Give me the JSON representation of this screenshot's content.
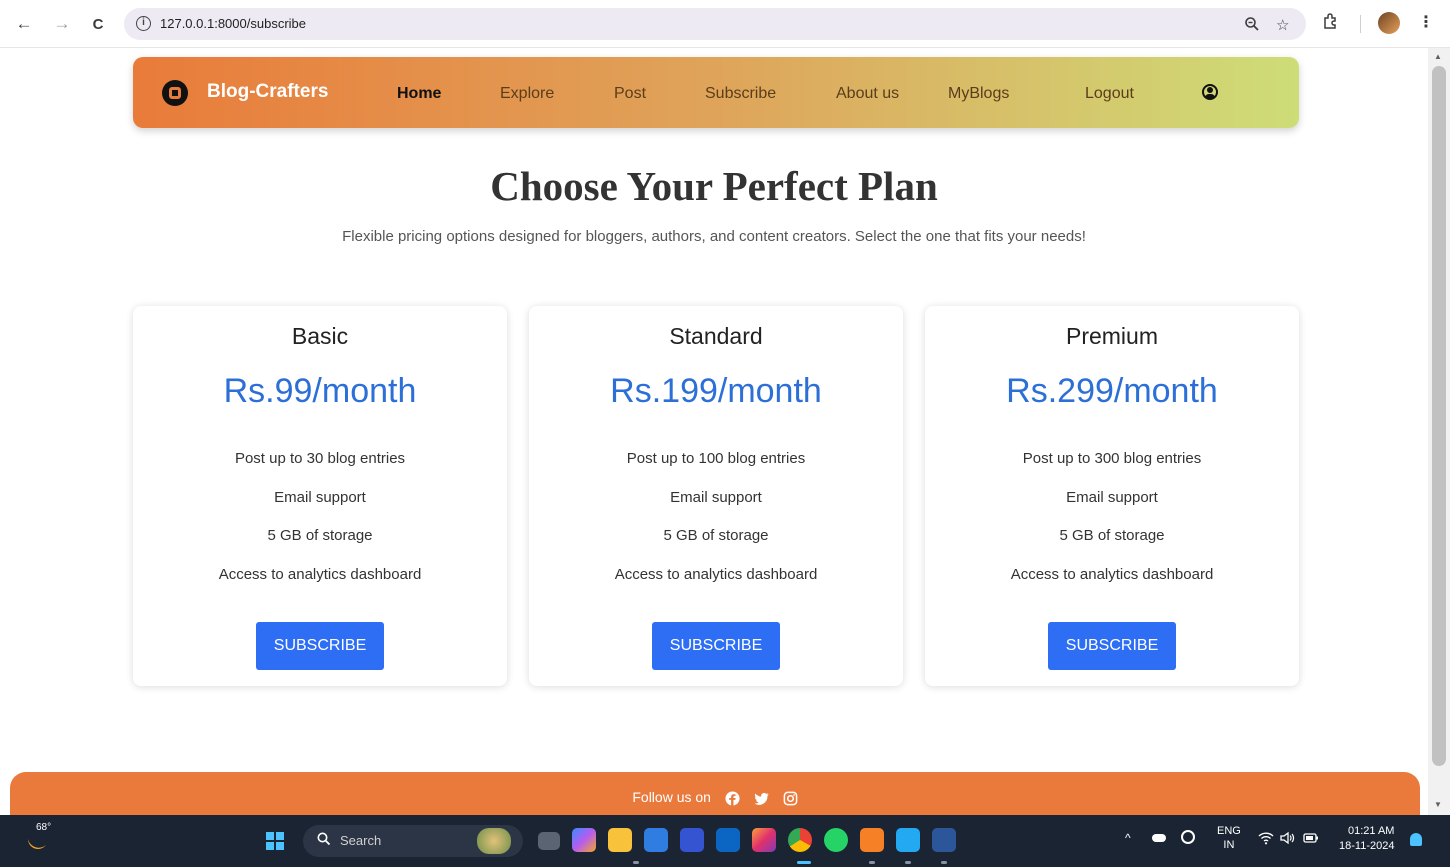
{
  "browser": {
    "url": "127.0.0.1:8000/subscribe",
    "back_icon": "←",
    "forward_icon": "→",
    "reload_icon": "C"
  },
  "navbar": {
    "brand": "Blog-Crafters",
    "links": [
      {
        "label": "Home",
        "active": true
      },
      {
        "label": "Explore"
      },
      {
        "label": "Post"
      },
      {
        "label": "Subscribe"
      },
      {
        "label": "About us"
      },
      {
        "label": "MyBlogs"
      },
      {
        "label": "Logout"
      }
    ],
    "gradient": [
      "#e97b3a",
      "#dfa45a",
      "#cedd78"
    ]
  },
  "hero": {
    "title": "Choose Your Perfect Plan",
    "subtitle": "Flexible pricing options designed for bloggers, authors, and content creators. Select the one that fits your needs!"
  },
  "plans": [
    {
      "name": "Basic",
      "price": "Rs.99/month",
      "features": [
        "Post up to 30 blog entries",
        "Email support",
        "5 GB of storage",
        "Access to analytics dashboard"
      ],
      "button": "SUBSCRIBE"
    },
    {
      "name": "Standard",
      "price": "Rs.199/month",
      "features": [
        "Post up to 100 blog entries",
        "Email support",
        "5 GB of storage",
        "Access to analytics dashboard"
      ],
      "button": "SUBSCRIBE"
    },
    {
      "name": "Premium",
      "price": "Rs.299/month",
      "features": [
        "Post up to 300 blog entries",
        "Email support",
        "5 GB of storage",
        "Access to analytics dashboard"
      ],
      "button": "SUBSCRIBE"
    }
  ],
  "footer": {
    "text": "Follow us on",
    "icons": [
      "facebook-icon",
      "twitter-icon",
      "instagram-icon"
    ]
  },
  "taskbar": {
    "weather_temp": "68°",
    "search_label": "Search",
    "lang_top": "ENG",
    "lang_bottom": "IN",
    "time": "01:21 AM",
    "date": "18-11-2024"
  },
  "colors": {
    "accent": "#2d6ef5",
    "price": "#2c6fd6",
    "footer": "#ea7a3c"
  }
}
